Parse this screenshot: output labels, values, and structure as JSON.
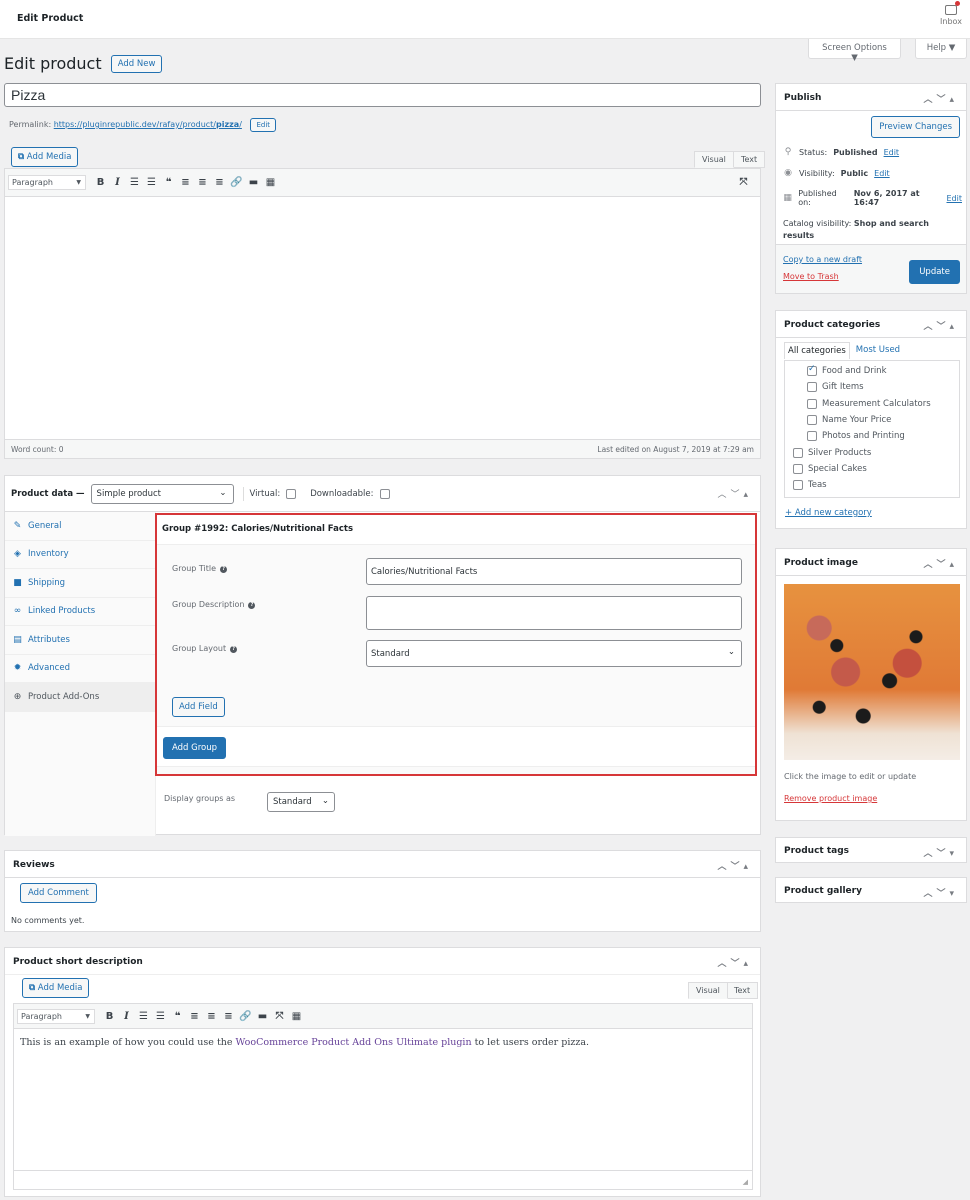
{
  "topbar": {
    "title": "Edit Product",
    "inbox_label": "Inbox"
  },
  "screen_options": "Screen Options ▼",
  "help": "Help ▼",
  "page_title": "Edit product",
  "add_new": "Add New",
  "product_title": "Pizza",
  "permalink": {
    "label": "Permalink:",
    "url_prefix": "https://pluginrepublic.dev/rafay/product/",
    "slug": "pizza",
    "url_suffix": "/",
    "edit": "Edit"
  },
  "editor": {
    "add_media": "Add Media",
    "tab_visual": "Visual",
    "tab_text": "Text",
    "format": "Paragraph",
    "word_count": "Word count: 0",
    "last_edited": "Last edited on August 7, 2019 at 7:29 am"
  },
  "toolbar_icons": [
    "bold-icon",
    "italic-icon",
    "bullet-list-icon",
    "numbered-list-icon",
    "blockquote-icon",
    "align-left-icon",
    "align-center-icon",
    "align-right-icon",
    "link-icon",
    "read-more-icon",
    "toolbar-toggle-icon"
  ],
  "product_data": {
    "label": "Product data —",
    "type": "Simple product",
    "virtual": "Virtual:",
    "downloadable": "Downloadable:",
    "tabs": [
      {
        "label": "General",
        "icon": "wrench-icon"
      },
      {
        "label": "Inventory",
        "icon": "tag-icon"
      },
      {
        "label": "Shipping",
        "icon": "truck-icon"
      },
      {
        "label": "Linked Products",
        "icon": "link-icon"
      },
      {
        "label": "Attributes",
        "icon": "table-icon"
      },
      {
        "label": "Advanced",
        "icon": "gear-icon"
      },
      {
        "label": "Product Add-Ons",
        "icon": "plus-circle-icon"
      }
    ],
    "group": {
      "header": "Group #1992: Calories/Nutritional Facts",
      "title_label": "Group Title",
      "title_value": "Calories/Nutritional Facts",
      "desc_label": "Group Description",
      "desc_value": "",
      "layout_label": "Group Layout",
      "layout_value": "Standard",
      "add_field": "Add Field",
      "add_group": "Add Group"
    },
    "display_groups_label": "Display groups as",
    "display_groups_value": "Standard"
  },
  "reviews": {
    "title": "Reviews",
    "add_comment": "Add Comment",
    "empty": "No comments yet."
  },
  "short_desc": {
    "title": "Product short description",
    "text_before": "This is an example of how you could use the ",
    "link_text": "WooCommerce Product Add Ons Ultimate plugin",
    "text_after": " to let users order pizza."
  },
  "publish": {
    "title": "Publish",
    "preview": "Preview Changes",
    "status_label": "Status:",
    "status_value": "Published",
    "visibility_label": "Visibility:",
    "visibility_value": "Public",
    "published_label": "Published on:",
    "published_value": "Nov 6, 2017 at 16:47",
    "catalog_label": "Catalog visibility:",
    "catalog_value": "Shop and search results",
    "edit": "Edit",
    "copy_draft": "Copy to a new draft",
    "trash": "Move to Trash",
    "update": "Update"
  },
  "categories": {
    "title": "Product categories",
    "tab_all": "All categories",
    "tab_most": "Most Used",
    "items": [
      {
        "label": "Food and Drink",
        "checked": true,
        "child": true
      },
      {
        "label": "Gift Items",
        "checked": false,
        "child": true
      },
      {
        "label": "Measurement Calculators",
        "checked": false,
        "child": true
      },
      {
        "label": "Name Your Price",
        "checked": false,
        "child": true
      },
      {
        "label": "Photos and Printing",
        "checked": false,
        "child": true
      },
      {
        "label": "Silver Products",
        "checked": false,
        "child": false
      },
      {
        "label": "Special Cakes",
        "checked": false,
        "child": false
      },
      {
        "label": "Teas",
        "checked": false,
        "child": false
      }
    ],
    "add_new": "+ Add new category"
  },
  "product_image": {
    "title": "Product image",
    "hint": "Click the image to edit or update",
    "remove": "Remove product image"
  },
  "product_tags": {
    "title": "Product tags"
  },
  "product_gallery": {
    "title": "Product gallery"
  },
  "colors": {
    "accent": "#2271b1",
    "danger": "#d63638",
    "highlight_border": "#d63638",
    "link_purple": "#674399"
  }
}
